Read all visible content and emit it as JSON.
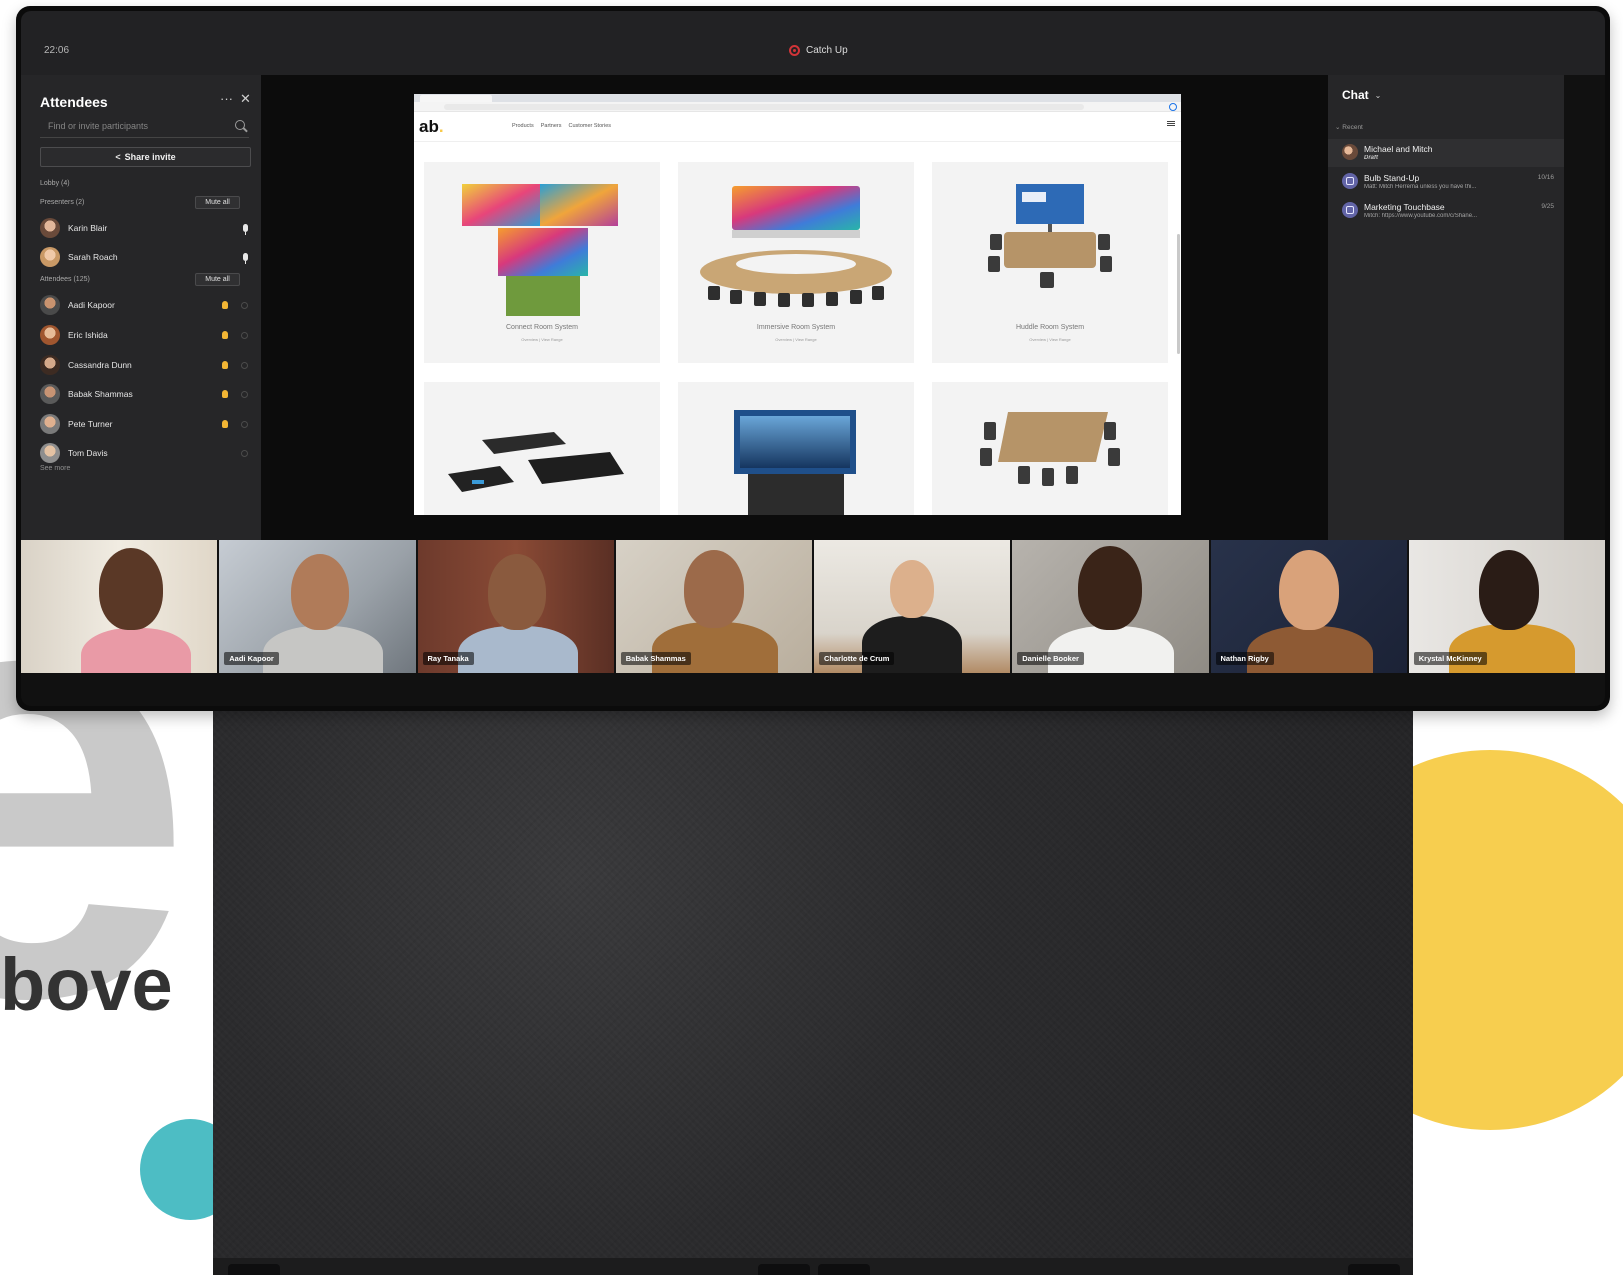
{
  "background": {
    "big_letter": "e",
    "partial_word": "bove",
    "colors": {
      "teal": "#4dbdc4",
      "yellow": "#f7ce4f",
      "gray": "#c9c9c9"
    }
  },
  "topbar": {
    "clock": "22:06",
    "catch_up_label": "Catch Up"
  },
  "attendees_panel": {
    "title": "Attendees",
    "more_label": "···",
    "close_label": "✕",
    "search_placeholder": "Find or invite participants",
    "share_invite_label": "Share invite",
    "lobby_label": "Lobby (4)",
    "presenters_label": "Presenters (2)",
    "attendees_label": "Attendees (125)",
    "mute_all_label": "Mute all",
    "presenters": [
      {
        "name": "Karin Blair",
        "status": "mic"
      },
      {
        "name": "Sarah Roach",
        "status": "mic"
      }
    ],
    "attendees": [
      {
        "name": "Aadi Kapoor",
        "status": "hand"
      },
      {
        "name": "Eric Ishida",
        "status": "hand"
      },
      {
        "name": "Cassandra Dunn",
        "status": "hand"
      },
      {
        "name": "Babak Shammas",
        "status": "hand"
      },
      {
        "name": "Pete Turner",
        "status": "hand"
      },
      {
        "name": "Tom Davis",
        "status": "muted"
      }
    ],
    "see_more_label": "See more"
  },
  "shared_browser": {
    "logo": "ab",
    "logo_dot": ".",
    "nav": [
      "Products",
      "Partners",
      "Customer Stories"
    ],
    "products": [
      {
        "title": "Connect Room System",
        "links": "Overview | View Range"
      },
      {
        "title": "Immersive Room System",
        "links": "Overview | View Range"
      },
      {
        "title": "Huddle Room System",
        "links": "Overview | View Range"
      }
    ]
  },
  "chat_panel": {
    "title": "Chat",
    "recent_label": "Recent",
    "items": [
      {
        "name": "Michael and Mitch",
        "preview": "Draft",
        "date": ""
      },
      {
        "name": "Bulb Stand-Up",
        "preview": "Matt: Mitch Herrema unless you have thi...",
        "date": "10/16"
      },
      {
        "name": "Marketing Touchbase",
        "preview": "Mitch: https://www.youtube.com/c/Shane...",
        "date": "9/25"
      }
    ]
  },
  "gallery": {
    "participants": [
      "",
      "Aadi Kapoor",
      "Ray Tanaka",
      "Babak Shammas",
      "Charlotte de Crum",
      "Danielle Booker",
      "Nathan Rigby",
      "Krystal McKinney"
    ]
  }
}
